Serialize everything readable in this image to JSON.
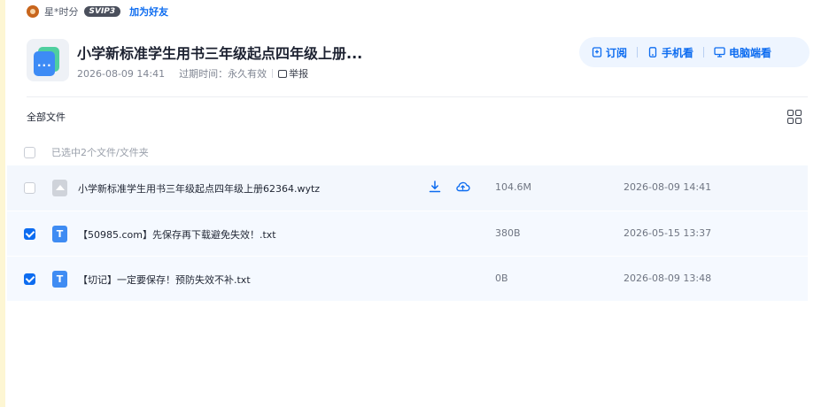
{
  "user": {
    "name": "星*时分",
    "vip_badge": "SVIP3",
    "add_friend": "加为好友"
  },
  "share": {
    "title": "小学新标准学生用书三年级起点四年级上册...",
    "date": "2026-08-09 14:41",
    "expire": "过期时间：永久有效",
    "report": "举报"
  },
  "actions": {
    "subscribe": "订阅",
    "phone": "手机看",
    "pc": "电脑端看"
  },
  "toolbar": {
    "all_files": "全部文件",
    "selected": "已选中2个文件/文件夹"
  },
  "files": [
    {
      "name": "小学新标准学生用书三年级起点四年级上册62364.wytz",
      "size": "104.6M",
      "date": "2026-08-09 14:41",
      "checked": false,
      "type": "unknown"
    },
    {
      "name": "【50985.com】先保存再下载避免失效！.txt",
      "size": "380B",
      "date": "2026-05-15 13:37",
      "checked": true,
      "type": "txt",
      "icon_letter": "T"
    },
    {
      "name": "【切记】一定要保存！预防失效不补.txt",
      "size": "0B",
      "date": "2026-08-09 13:48",
      "checked": true,
      "type": "txt",
      "icon_letter": "T"
    }
  ],
  "colors": {
    "accent": "#0d6cf0",
    "row_highlight": "#f3f7fd",
    "pill_bg": "#eef5ff",
    "left_strip": "#fdf6d3"
  }
}
